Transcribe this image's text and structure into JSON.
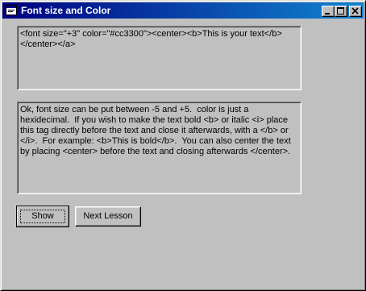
{
  "window": {
    "title": "Font size and Color",
    "icon": "app-window-icon",
    "controls": [
      "minimize-icon",
      "maximize-icon",
      "close-icon"
    ]
  },
  "code_box": {
    "value": "<font size=\"+3\" color=\"#cc3300\"><center><b>This is your text</b></center></a>"
  },
  "description_box": {
    "value": "Ok, font size can be put between -5 and +5.  color is just a hexidecimal.  If you wish to make the text bold <b> or italic <i> place this tag directly before the text and close it afterwards, with a </b> or </i>.  For example: <b>This is bold</b>.  You can also center the text by placing <center> before the text and closing afterwards </center>."
  },
  "buttons": {
    "show_label": "Show",
    "next_label": "Next Lesson"
  },
  "colors": {
    "face": "#c0c0c0",
    "title_start": "#000080",
    "title_end": "#1084d0"
  }
}
